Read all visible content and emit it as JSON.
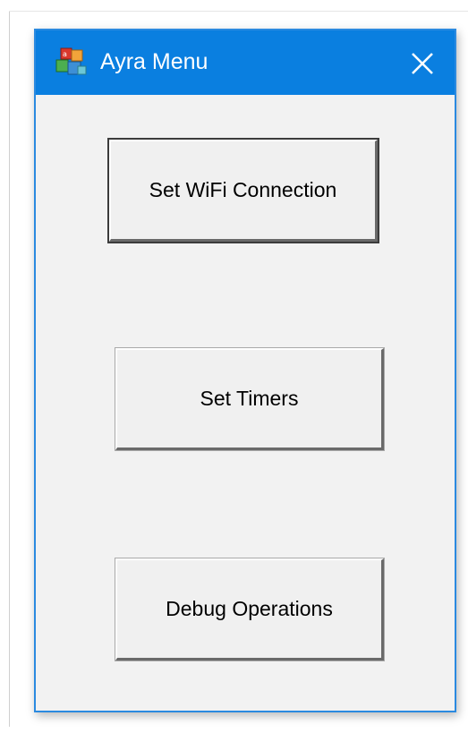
{
  "window": {
    "title": "Ayra Menu",
    "app_icon": "app-blocks-icon",
    "close_icon": "close-icon"
  },
  "menu": {
    "buttons": [
      {
        "label": "Set WiFi Connection"
      },
      {
        "label": "Set Timers"
      },
      {
        "label": "Debug Operations"
      }
    ]
  },
  "colors": {
    "titlebar": "#0a7fe0",
    "border": "#2b8ae0",
    "client_bg": "#f2f2f2",
    "button_bg": "#f0f0f0"
  }
}
